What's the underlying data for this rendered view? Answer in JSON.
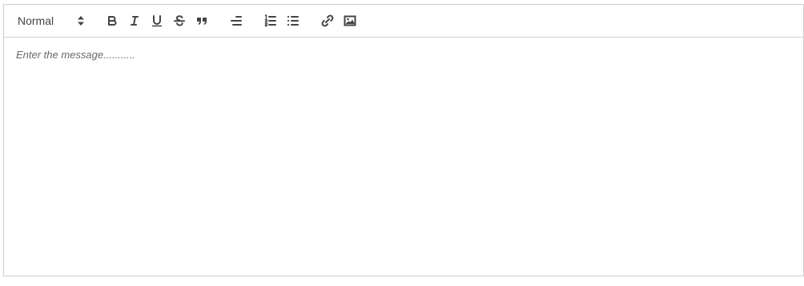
{
  "toolbar": {
    "header_value": "Normal",
    "buttons": {
      "bold": "bold-icon",
      "italic": "italic-icon",
      "underline": "underline-icon",
      "strike": "strikethrough-icon",
      "blockquote": "blockquote-icon",
      "align": "align-right-icon",
      "ordered_list": "ordered-list-icon",
      "bullet_list": "bullet-list-icon",
      "link": "link-icon",
      "image": "image-icon"
    }
  },
  "editor": {
    "placeholder": "Enter the message..........."
  },
  "colors": {
    "border": "#cccccc",
    "icon": "#444444",
    "placeholder": "#999999"
  }
}
